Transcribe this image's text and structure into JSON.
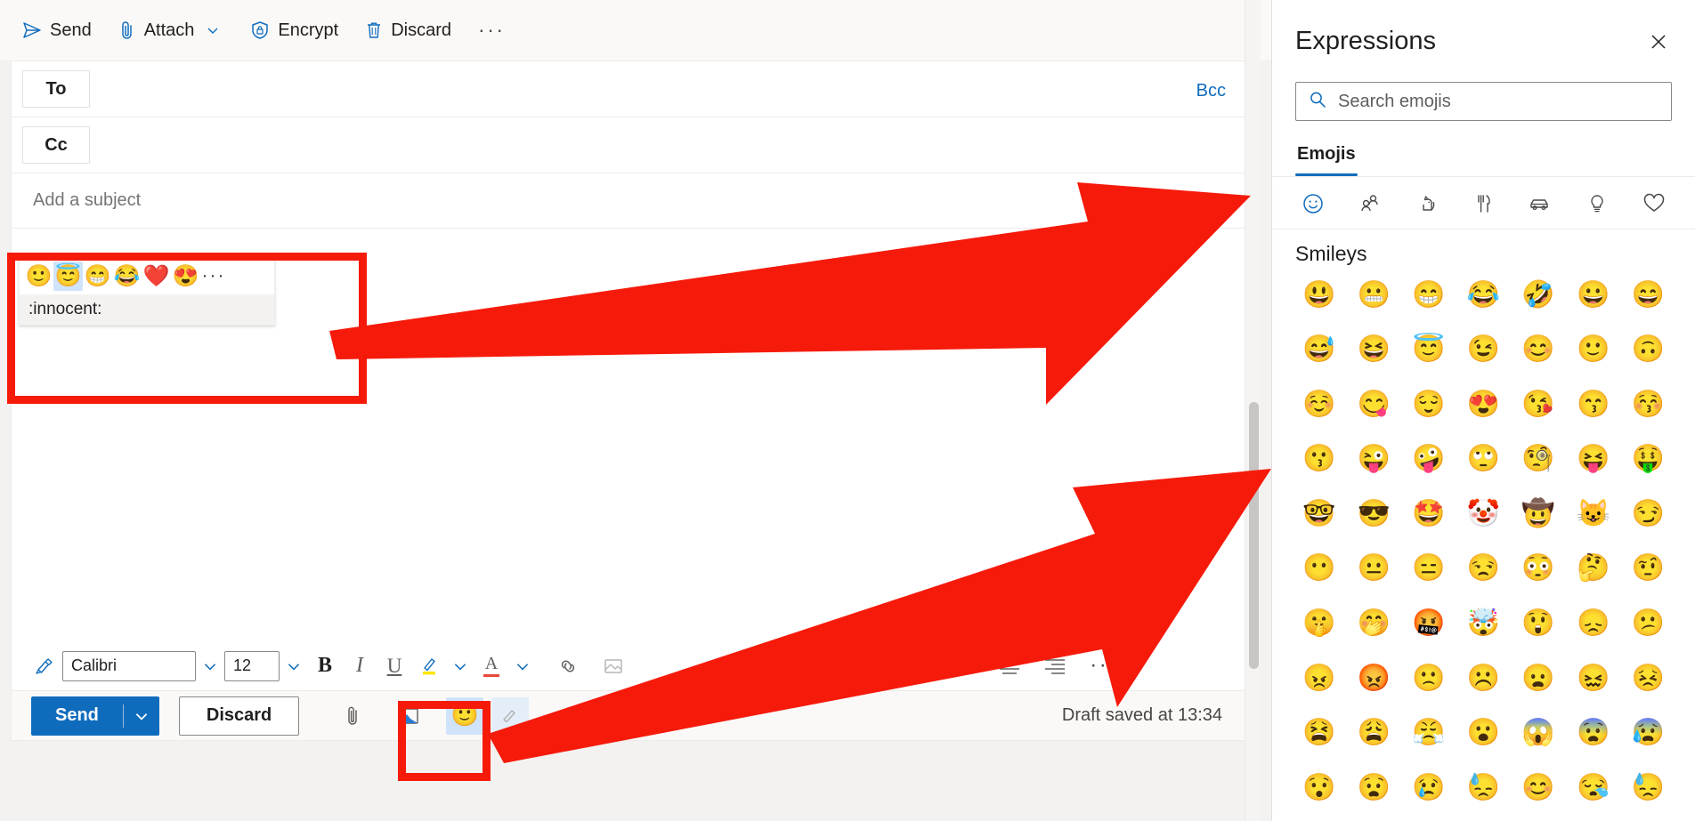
{
  "top_toolbar": {
    "send_label": "Send",
    "attach_label": "Attach",
    "encrypt_label": "Encrypt",
    "discard_label": "Discard",
    "overflow_label": "···"
  },
  "compose": {
    "to_label": "To",
    "cc_label": "Cc",
    "bcc_label": "Bcc",
    "to_value": "",
    "cc_value": "",
    "subject_placeholder": "Add a subject",
    "subject_value": "",
    "body_text": ":"
  },
  "emoji_autocomplete": {
    "suggestions": [
      {
        "glyph": "🙂",
        "name": "slightly-smiling-face",
        "selected": false
      },
      {
        "glyph": "😇",
        "name": "innocent",
        "selected": true
      },
      {
        "glyph": "😁",
        "name": "beaming-face",
        "selected": false
      },
      {
        "glyph": "😂",
        "name": "face-with-tears-of-joy",
        "selected": false
      },
      {
        "glyph": "❤️",
        "name": "red-heart",
        "selected": false
      },
      {
        "glyph": "😍",
        "name": "smiling-face-with-heart-eyes",
        "selected": false
      }
    ],
    "more_label": "···",
    "shortcode_label": ":innocent:"
  },
  "format_toolbar": {
    "font_name": "Calibri",
    "font_size": "12",
    "bold_label": "B",
    "italic_label": "I",
    "underline_label": "U",
    "font_color_label": "A",
    "quote_label": "”",
    "overflow_label": "···"
  },
  "send_bar": {
    "send_label": "Send",
    "discard_label": "Discard",
    "overflow_label": "···",
    "draft_status": "Draft saved at 13:34"
  },
  "expressions": {
    "title": "Expressions",
    "close_label": "✕",
    "search_placeholder": "Search emojis",
    "search_value": "",
    "tabs": [
      {
        "label": "Emojis",
        "active": true
      }
    ],
    "categories": [
      {
        "name": "smileys",
        "active": true
      },
      {
        "name": "people",
        "active": false
      },
      {
        "name": "animals",
        "active": false
      },
      {
        "name": "food",
        "active": false
      },
      {
        "name": "travel",
        "active": false
      },
      {
        "name": "objects",
        "active": false
      },
      {
        "name": "symbols",
        "active": false
      }
    ],
    "section_title": "Smileys",
    "emoji_grid": [
      "😃",
      "😬",
      "😁",
      "😂",
      "🤣",
      "😀",
      "😄",
      "😅",
      "😆",
      "😇",
      "😉",
      "😊",
      "🙂",
      "🙃",
      "☺️",
      "😋",
      "😌",
      "😍",
      "😘",
      "😙",
      "😚",
      "😗",
      "😜",
      "🤪",
      "🙄",
      "🧐",
      "😝",
      "🤑",
      "🤓",
      "😎",
      "🤩",
      "🤡",
      "🤠",
      "😺",
      "😏",
      "😶",
      "😐",
      "😑",
      "😒",
      "😳",
      "🤔",
      "🤨",
      "🤫",
      "🤭",
      "🤬",
      "🤯",
      "😲",
      "😞",
      "😕",
      "😠",
      "😡",
      "🙁",
      "☹️",
      "😦",
      "😖",
      "😣",
      "😫",
      "😩",
      "😤",
      "😮",
      "😱",
      "😨",
      "😰",
      "😯",
      "😧",
      "😢",
      "😓",
      "😊",
      "😪",
      "😓"
    ]
  },
  "annotations": {
    "highlight_color": "#f61a0b",
    "boxes": [
      {
        "name": "emoji-autocomplete-highlight"
      },
      {
        "name": "emoji-toolbar-button-highlight"
      }
    ],
    "arrows": [
      {
        "name": "arrow-to-autocomplete"
      },
      {
        "name": "arrow-to-emoji-button"
      }
    ]
  }
}
